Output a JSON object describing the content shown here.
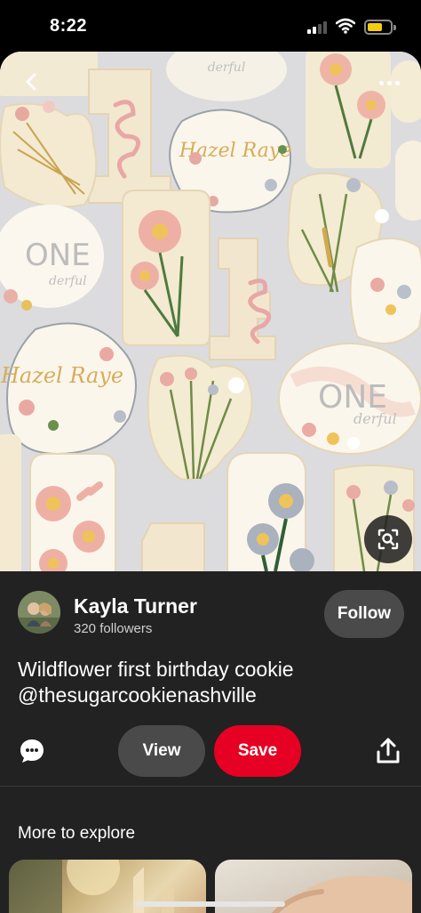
{
  "status_bar": {
    "time": "8:22",
    "battery_color": "#f5cc11"
  },
  "hero": {
    "image_description_icon": "cookie-photo",
    "back_icon": "chevron-left-icon",
    "more_icon": "more-horizontal-icon",
    "lens_icon": "visual-search-icon",
    "cookie_text": {
      "hazel_raye": "Hazel Raye",
      "one": "ONE",
      "derful": "derful",
      "one_big": "1"
    }
  },
  "creator": {
    "name": "Kayla Turner",
    "followers": "320 followers",
    "follow_label": "Follow"
  },
  "pin": {
    "title": "Wildflower first birthday cookie @thesugarcookienashville"
  },
  "actions": {
    "comment_icon": "comment-icon",
    "view_label": "View",
    "save_label": "Save",
    "share_icon": "share-icon",
    "save_color": "#e60023"
  },
  "explore": {
    "title": "More to explore"
  }
}
